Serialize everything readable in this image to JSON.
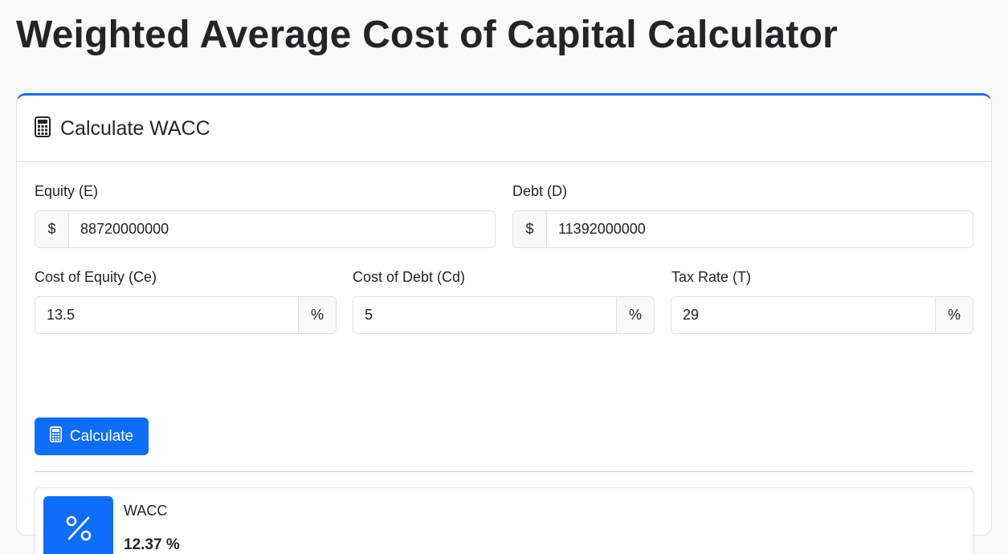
{
  "page": {
    "title": "Weighted Average Cost of Capital Calculator"
  },
  "card": {
    "title": "Calculate WACC",
    "icon": "calculator-icon",
    "accent": "#0d6efd"
  },
  "fields": {
    "equity": {
      "label": "Equity (E)",
      "prefix": "$",
      "value": "88720000000"
    },
    "debt": {
      "label": "Debt (D)",
      "prefix": "$",
      "value": "11392000000"
    },
    "cost_of_equity": {
      "label": "Cost of Equity (Ce)",
      "suffix": "%",
      "value": "13.5"
    },
    "cost_of_debt": {
      "label": "Cost of Debt (Cd)",
      "suffix": "%",
      "value": "5"
    },
    "tax_rate": {
      "label": "Tax Rate (T)",
      "suffix": "%",
      "value": "29"
    }
  },
  "actions": {
    "calculate_label": "Calculate",
    "calculate_icon": "calculator-icon"
  },
  "result": {
    "label": "WACC",
    "value": "12.37 %",
    "icon": "percent-icon"
  }
}
